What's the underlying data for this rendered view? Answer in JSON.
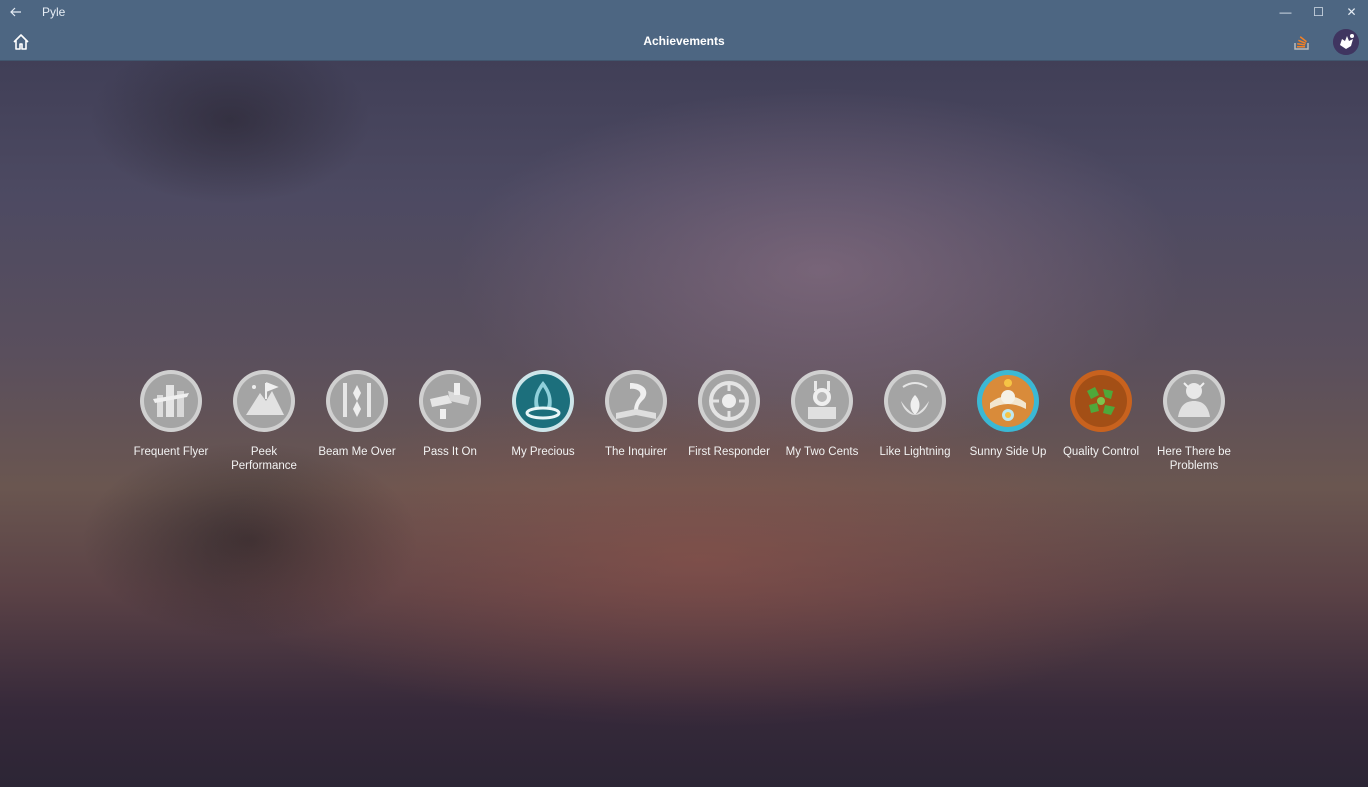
{
  "window": {
    "title": "Pyle",
    "back_icon": "back-arrow-icon",
    "minimize_symbol": "—",
    "maximize_symbol": "☐",
    "close_symbol": "✕"
  },
  "header": {
    "title": "Achievements",
    "home_icon": "home-icon",
    "stackoverflow_icon": "stackoverflow-icon",
    "avatar_icon": "avatar-icon",
    "accent": "#4d6682",
    "stackoverflow_color": "#f48024"
  },
  "achievements": [
    {
      "label": "Frequent Flyer",
      "earned": false
    },
    {
      "label": "Peek Performance",
      "earned": false
    },
    {
      "label": "Beam Me Over",
      "earned": false
    },
    {
      "label": "Pass It On",
      "earned": false
    },
    {
      "label": "My Precious",
      "earned": true,
      "color": "#1c6f7c"
    },
    {
      "label": "The Inquirer",
      "earned": false
    },
    {
      "label": "First Responder",
      "earned": false
    },
    {
      "label": "My Two Cents",
      "earned": false
    },
    {
      "label": "Like Lightning",
      "earned": false
    },
    {
      "label": "Sunny Side Up",
      "earned": true,
      "color": "#3bb8d4"
    },
    {
      "label": "Quality Control",
      "earned": true,
      "color": "#c8621e"
    },
    {
      "label": "Here There be Problems",
      "earned": false
    }
  ]
}
